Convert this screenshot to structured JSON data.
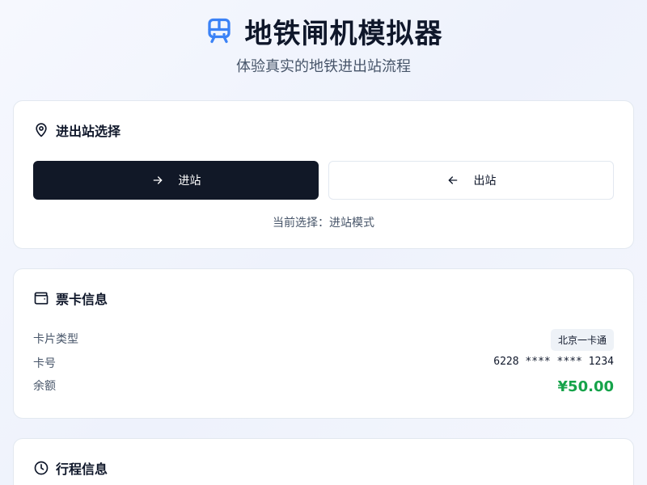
{
  "header": {
    "title": "地铁闸机模拟器",
    "subtitle": "体验真实的地铁进出站流程",
    "accent_color": "#3b82f6",
    "icon": "train-icon"
  },
  "station_select": {
    "title": "进出站选择",
    "icon": "map-pin-icon",
    "enter_label": "进站",
    "enter_icon": "arrow-right-icon",
    "exit_label": "出站",
    "exit_icon": "arrow-left-icon",
    "selected": "enter",
    "current_selection": "当前选择：进站模式"
  },
  "card_info": {
    "title": "票卡信息",
    "icon": "wallet-icon",
    "type_label": "卡片类型",
    "type_value": "北京一卡通",
    "number_label": "卡号",
    "number_value": "6228 **** **** 1234",
    "balance_label": "余额",
    "balance_value": "¥50.00",
    "balance_color": "#16a34a"
  },
  "trip_info": {
    "title": "行程信息",
    "icon": "clock-icon"
  }
}
